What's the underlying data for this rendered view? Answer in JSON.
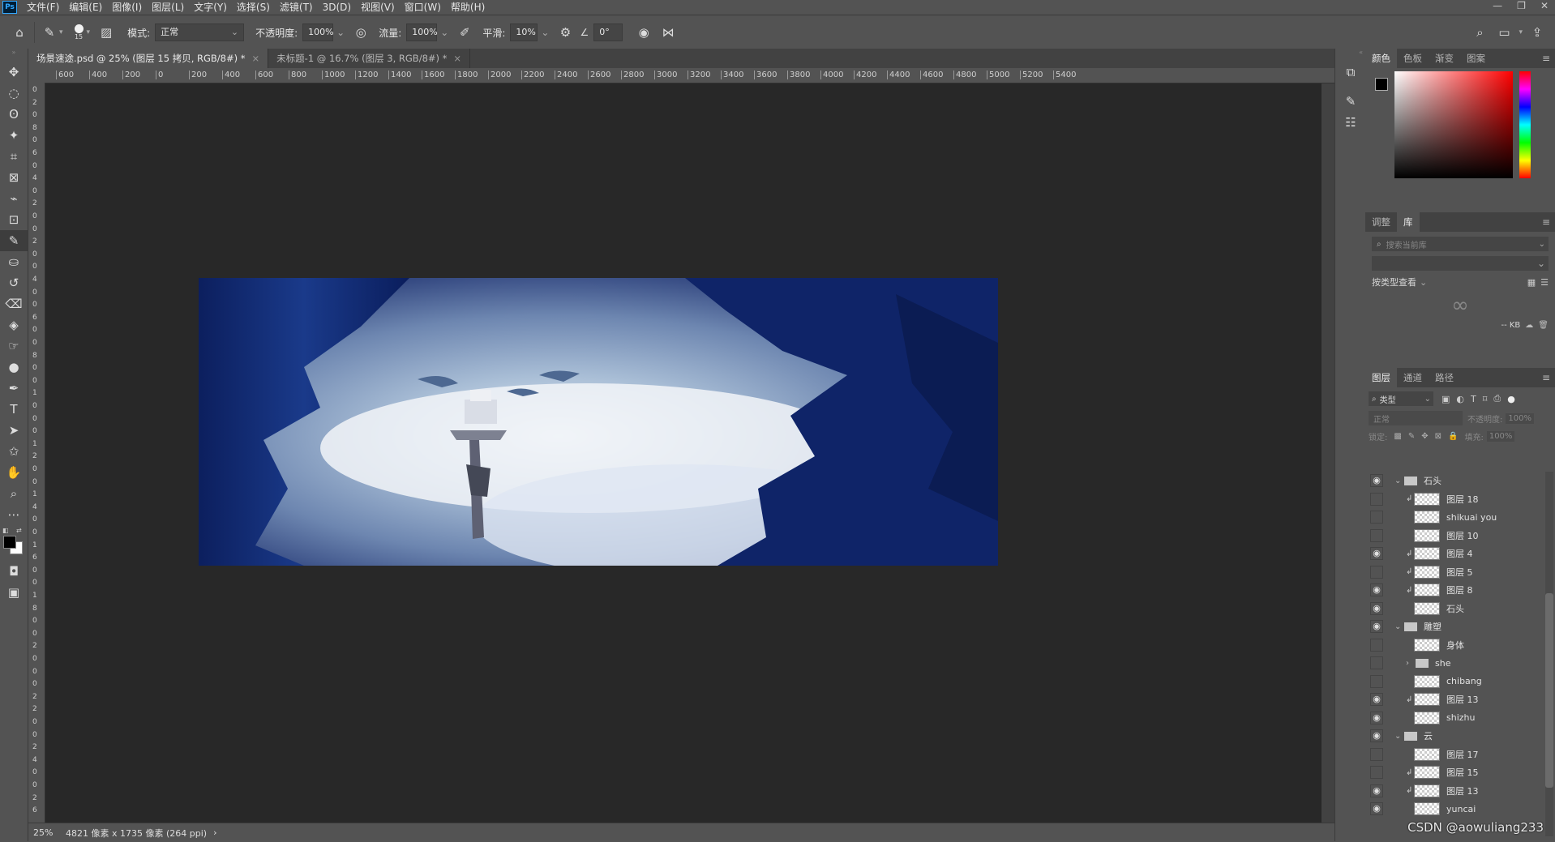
{
  "menu": {
    "items": [
      "文件(F)",
      "编辑(E)",
      "图像(I)",
      "图层(L)",
      "文字(Y)",
      "选择(S)",
      "滤镜(T)",
      "3D(D)",
      "视图(V)",
      "窗口(W)",
      "帮助(H)"
    ],
    "logo": "Ps"
  },
  "options": {
    "brush_size": "15",
    "mode_label": "模式:",
    "mode_value": "正常",
    "opacity_label": "不透明度:",
    "opacity_value": "100%",
    "flow_label": "流量:",
    "flow_value": "100%",
    "smooth_label": "平滑:",
    "smooth_value": "10%",
    "angle_value": "0°"
  },
  "tabs": [
    {
      "label": "场景速途.psd @ 25% (图层 15 拷贝, RGB/8#) *"
    },
    {
      "label": "未标题-1 @ 16.7% (图层 3, RGB/8#) *"
    }
  ],
  "ruler": {
    "h_labels": [
      "600",
      "400",
      "200",
      "0",
      "200",
      "400",
      "600",
      "800",
      "1000",
      "1200",
      "1400",
      "1600",
      "1800",
      "2000",
      "2200",
      "2400",
      "2600",
      "2800",
      "3000",
      "3200",
      "3400",
      "3600",
      "3800",
      "4000",
      "4200",
      "4400",
      "4600",
      "4800",
      "5000",
      "5200",
      "5400"
    ],
    "v_labels": [
      "0",
      "2",
      "0",
      "8",
      "0",
      "6",
      "0",
      "4",
      "0",
      "2",
      "0",
      "0",
      "2",
      "0",
      "0",
      "4",
      "0",
      "0",
      "6",
      "0",
      "0",
      "8",
      "0",
      "0",
      "1",
      "0",
      "0",
      "0",
      "1",
      "2",
      "0",
      "0",
      "1",
      "4",
      "0",
      "0",
      "1",
      "6",
      "0",
      "0",
      "1",
      "8",
      "0",
      "0",
      "2",
      "0",
      "0",
      "0",
      "2",
      "2",
      "0",
      "0",
      "2",
      "4",
      "0",
      "0",
      "2",
      "6"
    ]
  },
  "status": {
    "zoom": "25%",
    "doc_info": "4821 像素 x 1735 像素 (264 ppi)",
    "arrow": "›"
  },
  "color_panel": {
    "tabs": [
      "颜色",
      "色板",
      "渐变",
      "图案"
    ]
  },
  "library_panel": {
    "tabs": [
      "调整",
      "库"
    ],
    "search_placeholder": "搜索当前库",
    "view_by": "按类型查看",
    "size": "-- KB"
  },
  "layers_panel": {
    "tabs": [
      "图层",
      "通道",
      "路径"
    ],
    "filter_label": "类型",
    "blend_mode": "正常",
    "opacity_label": "不透明度:",
    "opacity_value": "100%",
    "lock_label": "锁定:",
    "fill_label": "填充:",
    "fill_value": "100%",
    "layers": [
      {
        "name": "石头",
        "type": "group",
        "visible": true,
        "indent": 1,
        "clip": false,
        "expanded": true
      },
      {
        "name": "图层 18",
        "type": "layer",
        "visible": false,
        "indent": 2,
        "clip": true
      },
      {
        "name": "shikuai you",
        "type": "layer",
        "visible": false,
        "indent": 2,
        "clip": false
      },
      {
        "name": "图层 10",
        "type": "layer",
        "visible": false,
        "indent": 2,
        "clip": false
      },
      {
        "name": "图层 4",
        "type": "layer",
        "visible": true,
        "indent": 2,
        "clip": true
      },
      {
        "name": "图层 5",
        "type": "layer",
        "visible": false,
        "indent": 2,
        "clip": true
      },
      {
        "name": "图层 8",
        "type": "layer",
        "visible": true,
        "indent": 2,
        "clip": true
      },
      {
        "name": "石头",
        "type": "layer",
        "visible": true,
        "indent": 2,
        "clip": false
      },
      {
        "name": "雕塑",
        "type": "group",
        "visible": true,
        "indent": 1,
        "clip": false,
        "expanded": true
      },
      {
        "name": "身体",
        "type": "layer",
        "visible": false,
        "indent": 2,
        "clip": false
      },
      {
        "name": "she",
        "type": "group",
        "visible": false,
        "indent": 2,
        "clip": false,
        "expanded": false
      },
      {
        "name": "chibang",
        "type": "layer",
        "visible": false,
        "indent": 2,
        "clip": false
      },
      {
        "name": "图层 13",
        "type": "layer",
        "visible": true,
        "indent": 2,
        "clip": true
      },
      {
        "name": "shizhu",
        "type": "layer",
        "visible": true,
        "indent": 2,
        "clip": false
      },
      {
        "name": "云",
        "type": "group",
        "visible": true,
        "indent": 1,
        "clip": false,
        "expanded": true
      },
      {
        "name": "图层 17",
        "type": "layer",
        "visible": false,
        "indent": 2,
        "clip": false
      },
      {
        "name": "图层 15",
        "type": "layer",
        "visible": false,
        "indent": 2,
        "clip": true
      },
      {
        "name": "图层 13",
        "type": "layer",
        "visible": true,
        "indent": 2,
        "clip": true
      },
      {
        "name": "yuncai",
        "type": "layer",
        "visible": true,
        "indent": 2,
        "clip": false
      }
    ]
  },
  "watermark": "CSDN @aowuliang233",
  "colors": {
    "ui_bg": "#535353",
    "canvas_bg": "#282828",
    "accent": "#31a8ff"
  }
}
